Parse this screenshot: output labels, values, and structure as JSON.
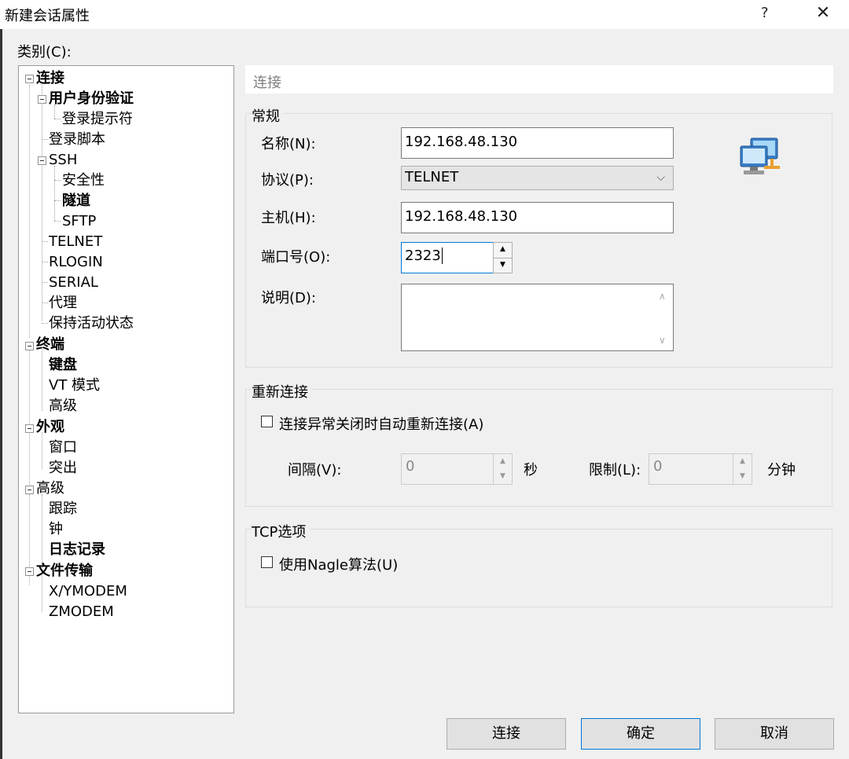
{
  "window": {
    "title": "新建会话属性",
    "help_label": "?",
    "close_label": "✕"
  },
  "category_label": "类别(C):",
  "tree": {
    "items": [
      {
        "label": "连接",
        "bold": true
      },
      {
        "label": "用户身份验证",
        "bold": true
      },
      {
        "label": "登录提示符",
        "bold": false
      },
      {
        "label": "登录脚本",
        "bold": false
      },
      {
        "label": "SSH",
        "bold": false
      },
      {
        "label": "安全性",
        "bold": false
      },
      {
        "label": "隧道",
        "bold": true
      },
      {
        "label": "SFTP",
        "bold": false
      },
      {
        "label": "TELNET",
        "bold": false
      },
      {
        "label": "RLOGIN",
        "bold": false
      },
      {
        "label": "SERIAL",
        "bold": false
      },
      {
        "label": "代理",
        "bold": false
      },
      {
        "label": "保持活动状态",
        "bold": false
      },
      {
        "label": "终端",
        "bold": true
      },
      {
        "label": "键盘",
        "bold": true
      },
      {
        "label": "VT 模式",
        "bold": false
      },
      {
        "label": "高级",
        "bold": false
      },
      {
        "label": "外观",
        "bold": true
      },
      {
        "label": "窗口",
        "bold": false
      },
      {
        "label": "突出",
        "bold": false
      },
      {
        "label": "高级",
        "bold": false
      },
      {
        "label": "跟踪",
        "bold": false
      },
      {
        "label": "钟",
        "bold": false
      },
      {
        "label": "日志记录",
        "bold": true
      },
      {
        "label": "文件传输",
        "bold": true
      },
      {
        "label": "X/YMODEM",
        "bold": false
      },
      {
        "label": "ZMODEM",
        "bold": false
      }
    ]
  },
  "panel": {
    "header": "连接",
    "general": {
      "title": "常规",
      "name_label": "名称(N):",
      "name_value": "192.168.48.130",
      "protocol_label": "协议(P):",
      "protocol_value": "TELNET",
      "host_label": "主机(H):",
      "host_value": "192.168.48.130",
      "port_label": "端口号(O):",
      "port_value": "2323",
      "desc_label": "说明(D):",
      "desc_value": ""
    },
    "reconnect": {
      "title": "重新连接",
      "auto_label": "连接异常关闭时自动重新连接(A)",
      "auto_checked": false,
      "interval_label": "间隔(V):",
      "interval_value": "0",
      "interval_unit": "秒",
      "limit_label": "限制(L):",
      "limit_value": "0",
      "limit_unit": "分钟"
    },
    "tcp": {
      "title": "TCP选项",
      "nagle_label": "使用Nagle算法(U)",
      "nagle_checked": false
    }
  },
  "buttons": {
    "connect": "连接",
    "ok": "确定",
    "cancel": "取消"
  },
  "icons": {
    "network": "network-computers-icon",
    "expand": "tree-collapse-icon"
  },
  "colors": {
    "focus_border": "#0078d7",
    "dialog_bg": "#f0f0f0",
    "header_text": "#808080"
  }
}
